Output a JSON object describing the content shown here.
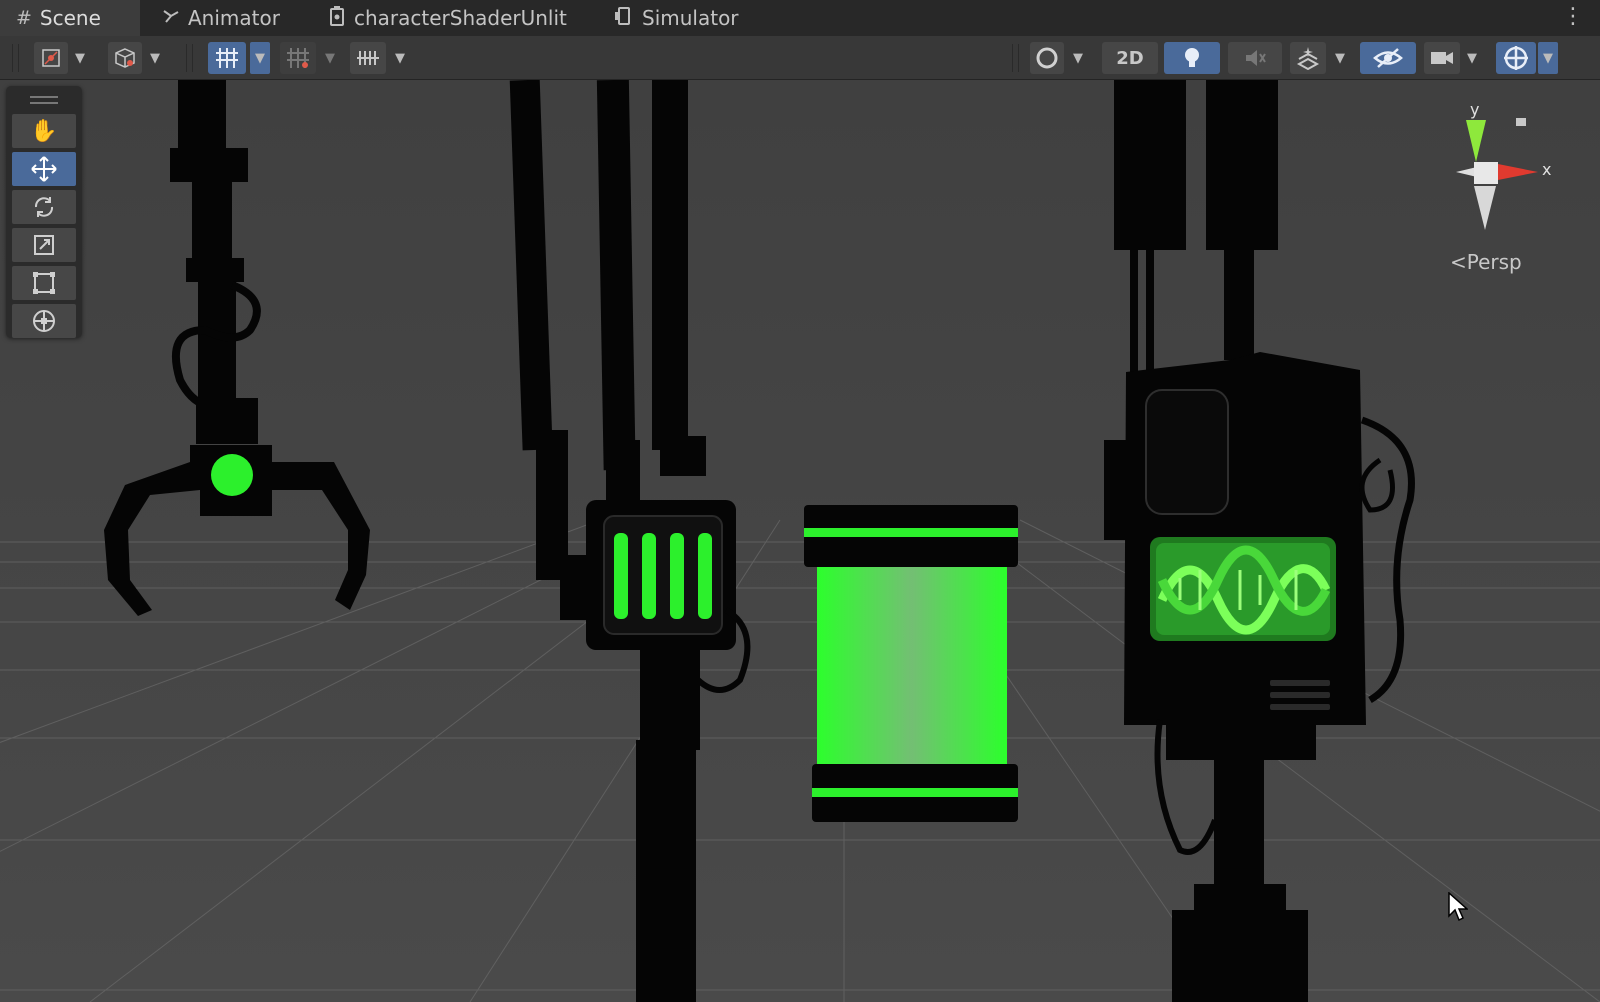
{
  "tabs": [
    {
      "label": "Scene",
      "icon": "grid-hash-icon",
      "active": true
    },
    {
      "label": "Animator",
      "icon": "animator-icon",
      "active": false
    },
    {
      "label": "characterShaderUnlit",
      "icon": "shader-graph-icon",
      "active": false
    },
    {
      "label": "Simulator",
      "icon": "device-simulator-icon",
      "active": false
    }
  ],
  "toolbar": {
    "mode_2d_label": "2D",
    "left_tools": [
      "draw-mode-icon",
      "render-mode-cube-icon",
      "grid-snap-icon",
      "incremental-snap-icon",
      "grid-ruler-icon"
    ],
    "right_tools": [
      "shading-sphere-icon",
      "2d-toggle",
      "lighting-bulb-icon",
      "audio-mute-icon",
      "effects-icon",
      "scene-visibility-icon",
      "camera-icon",
      "gizmos-icon"
    ]
  },
  "tools_palette": {
    "items": [
      "hand-tool-icon",
      "move-tool-icon",
      "rotate-tool-icon",
      "scale-tool-icon",
      "rect-tool-icon",
      "transform-tool-icon"
    ],
    "active_index": 1
  },
  "gizmo": {
    "y_label": "y",
    "x_label": "x",
    "projection_label": "Persp"
  },
  "colors": {
    "accent_active": "#4a6a9a",
    "glow_green": "#29ff2f",
    "axis_x": "#e03a2f",
    "axis_y": "#8ee83c",
    "silhouette": "#050505"
  }
}
